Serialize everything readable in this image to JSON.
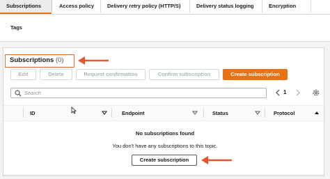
{
  "tabs": [
    {
      "label": "Subscriptions",
      "active": true
    },
    {
      "label": "Access policy",
      "active": false
    },
    {
      "label": "Delivery retry policy (HTTP/S)",
      "active": false
    },
    {
      "label": "Delivery status logging",
      "active": false
    },
    {
      "label": "Encryption",
      "active": false
    },
    {
      "label": "Tags",
      "active": false
    }
  ],
  "panel": {
    "title": "Subscriptions",
    "count": "(0)"
  },
  "actions": {
    "edit": "Edit",
    "delete": "Delete",
    "request_confirmation": "Request confirmation",
    "confirm_subscription": "Confirm subscription",
    "create_subscription": "Create subscription"
  },
  "search": {
    "placeholder": "Search"
  },
  "pagination": {
    "current_page": "1"
  },
  "table": {
    "columns": [
      "ID",
      "Endpoint",
      "Status",
      "Protocol"
    ],
    "empty_title": "No subscriptions found",
    "empty_description": "You don't have any subscriptions to this topic.",
    "empty_action": "Create subscription"
  },
  "colors": {
    "accent": "#ec7211",
    "annotation_arrow": "#e4572e"
  }
}
